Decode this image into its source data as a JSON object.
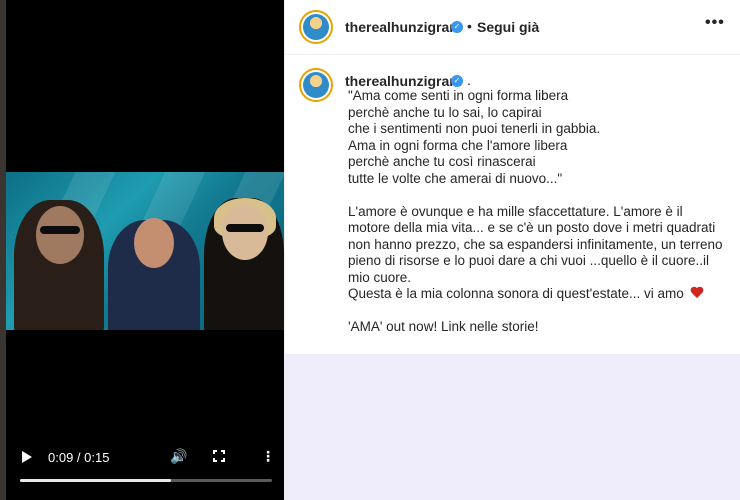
{
  "video": {
    "time_display": "0:09 / 0:15",
    "progress_fraction": 0.6
  },
  "post": {
    "header": {
      "username": "therealhunzigram",
      "separator": "•",
      "follow_status": "Segui già",
      "options": "•••"
    },
    "caption": {
      "username": "therealhunzigram",
      "trailing": ".",
      "lines_before_heart": "\"Ama come senti in ogni forma libera\nperchè anche tu lo sai, lo capirai\nche i sentimenti non puoi tenerli in gabbia.\nAma in ogni forma che l'amore libera\nperchè anche tu così rinascerai\ntutte le volte che amerai di nuovo...\"\n\nL'amore è ovunque e ha mille sfaccettature. L'amore è il motore della mia vita... e se c'è un posto dove i metri quadrati non hanno prezzo, che sa espandersi infinitamente, un terreno pieno di risorse e lo puoi dare a chi vuoi ...quello è il cuore..il mio cuore.\nQuesta è la mia colonna sonora di quest'estate... vi amo ",
      "lines_after_heart": "\n\n'AMA' out now! Link nelle storie!"
    }
  },
  "colors": {
    "verified": "#3897f0",
    "heart": "#d0261e",
    "empty_region": "#efedfc"
  },
  "icons": [
    "play-icon",
    "volume-icon",
    "fullscreen-icon",
    "more-options-icon",
    "verified-icon",
    "heart-icon",
    "options-icon"
  ]
}
